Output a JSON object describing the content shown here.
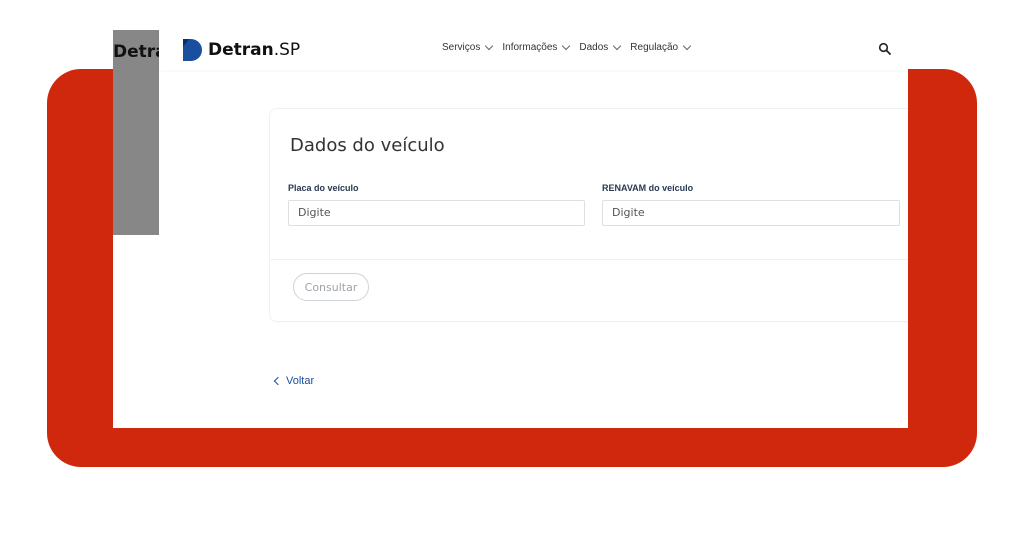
{
  "colors": {
    "frame_red": "#d0280c",
    "brand_blue": "#1a4fa0",
    "gray_strip": "#878787"
  },
  "background_window": {
    "partial_title": "Detra"
  },
  "header": {
    "logo": {
      "name": "Detran",
      "suffix": ".SP",
      "icon": "detran-logo-icon"
    },
    "nav": [
      {
        "label": "Serviços"
      },
      {
        "label": "Informações"
      },
      {
        "label": "Dados"
      },
      {
        "label": "Regulação"
      }
    ],
    "search_icon": "search-icon"
  },
  "form": {
    "title": "Dados do veículo",
    "plate": {
      "label": "Placa do veículo",
      "placeholder": "Digite"
    },
    "renavam": {
      "label": "RENAVAM do veículo",
      "placeholder": "Digite"
    },
    "submit_label": "Consultar"
  },
  "back": {
    "label": "Voltar"
  }
}
